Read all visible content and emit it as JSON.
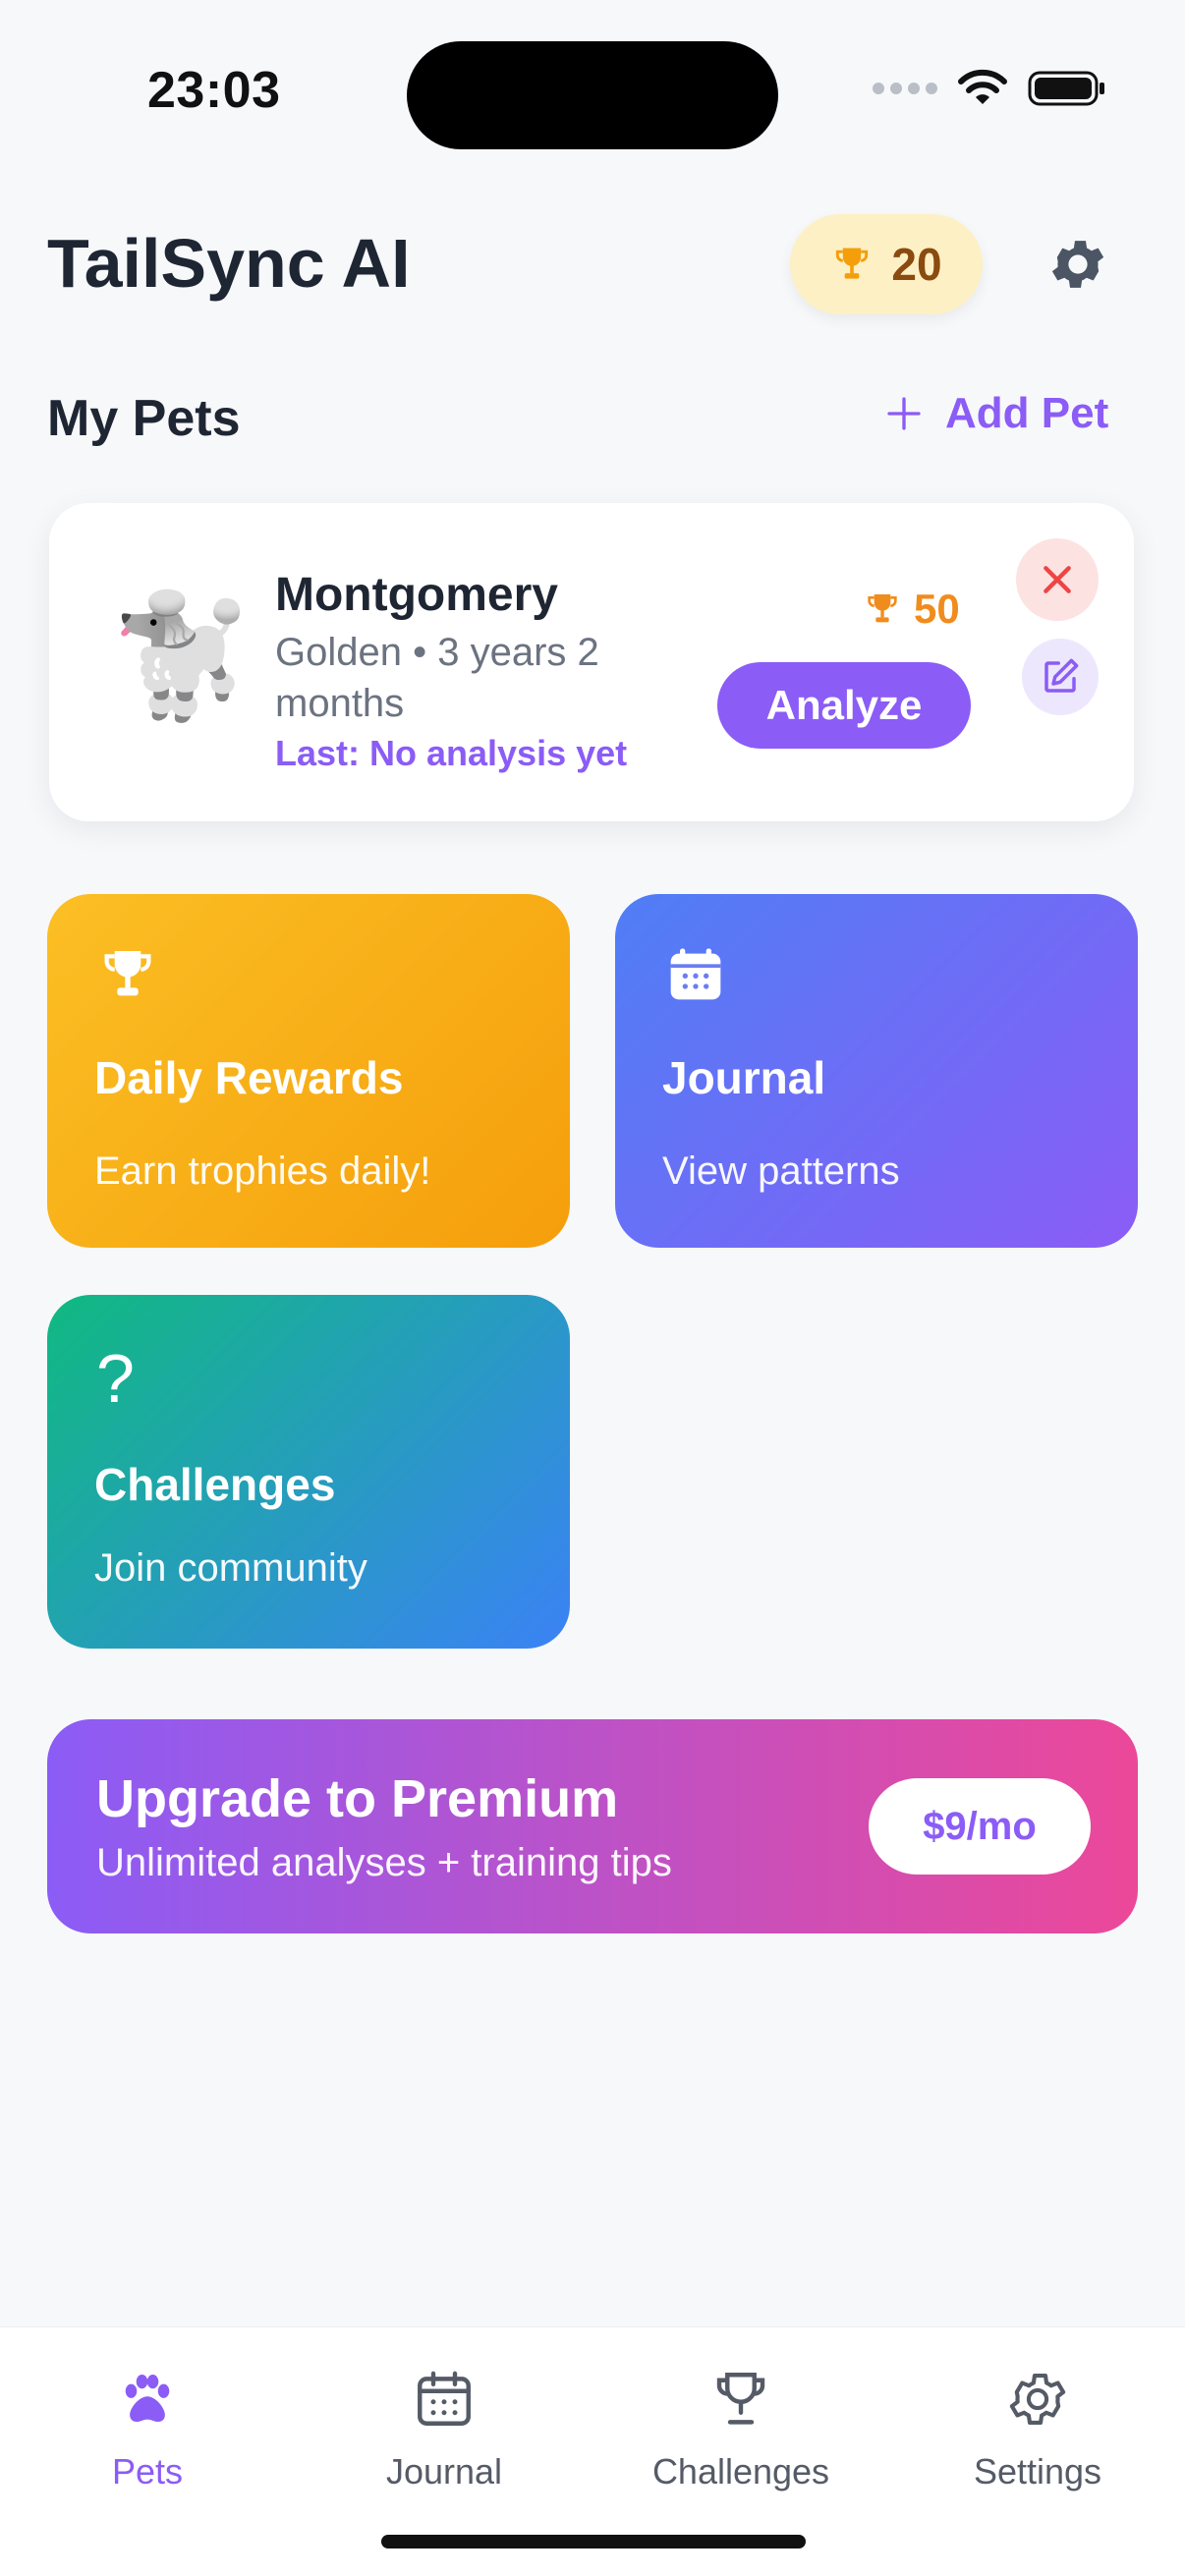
{
  "status_bar": {
    "time": "23:03"
  },
  "header": {
    "title": "TailSync AI",
    "trophy_count": "20"
  },
  "pets_section": {
    "title": "My Pets",
    "add_label": "Add Pet"
  },
  "pet_card": {
    "emoji": "🐩",
    "name": "Montgomery",
    "meta": "Golden • 3 years 2 months",
    "last_analysis": "Last: No analysis yet",
    "trophies": "50",
    "analyze_label": "Analyze"
  },
  "tiles": {
    "rewards": {
      "title": "Daily Rewards",
      "subtitle": "Earn trophies daily!"
    },
    "journal": {
      "title": "Journal",
      "subtitle": "View patterns"
    },
    "challenges": {
      "icon_glyph": "?",
      "title": "Challenges",
      "subtitle": "Join community"
    }
  },
  "premium": {
    "title": "Upgrade to Premium",
    "subtitle": "Unlimited analyses + training tips",
    "price": "$9/mo"
  },
  "tabbar": {
    "tabs": [
      {
        "label": "Pets",
        "icon": "paw-icon"
      },
      {
        "label": "Journal",
        "icon": "calendar-icon"
      },
      {
        "label": "Challenges",
        "icon": "trophy-icon"
      },
      {
        "label": "Settings",
        "icon": "gear-icon"
      }
    ],
    "active": "Pets"
  },
  "colors": {
    "accent": "#8b5cf6",
    "gold": "#f59e0b",
    "danger": "#ef4444"
  }
}
